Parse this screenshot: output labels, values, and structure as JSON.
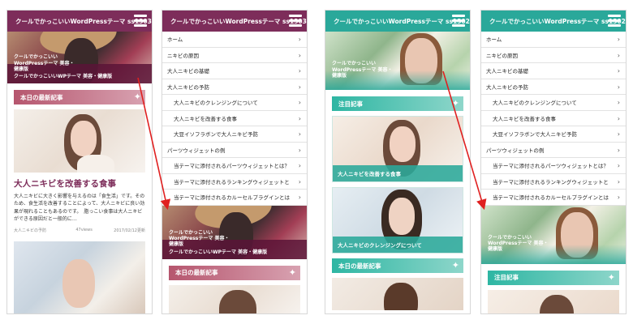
{
  "phones": [
    {
      "theme": "pink",
      "site_title": "クールでかっこいいWordPressテーマ ss1303",
      "hero_small": "クールでかっこいい WordPressテーマ 美容・健康版",
      "hero_caption": "クールでかっこいいWPテーマ 美容・健康版",
      "section_heading": "本日の最新記事",
      "article_title": "大人ニキビを改善する食事",
      "article_body": "大人ニキビに大きく影響を与えるのは「食生活」です。そのため、食生活を改善することによって、大人ニキビに良い効果が現れることもあるのです。　脂っこい食事は大人ニキビができる原因だと一般的に…",
      "meta_category": "大人ニキビの予防",
      "meta_views": "47views",
      "meta_date": "2017/02/12更新"
    },
    {
      "theme": "pink",
      "site_title": "クールでかっこいいWordPressテーマ ss1303",
      "hero_small": "クールでかっこいい WordPressテーマ 美容・健康版",
      "hero_caption": "クールでかっこいいWPテーマ 美容・健康版",
      "section_heading": "本日の最新記事"
    },
    {
      "theme": "teal",
      "site_title": "クールでかっこいいWordPressテーマ ss1302",
      "hero_caption": "クールでかっこいい WordPressテーマ 美容・健康版",
      "section_heading_1": "注目記事",
      "card_1_caption": "大人ニキビを改善する食事",
      "card_2_caption": "大人ニキビのクレンジングについて",
      "section_heading_2": "本日の最新記事"
    },
    {
      "theme": "teal",
      "site_title": "クールでかっこいいWordPressテーマ ss1302",
      "hero_caption": "クールでかっこいい WordPressテーマ 美容・健康版",
      "section_heading": "注目記事"
    }
  ],
  "menu": [
    {
      "label": "ホーム",
      "sub": false
    },
    {
      "label": "ニキビの原因",
      "sub": false
    },
    {
      "label": "大人ニキビの基礎",
      "sub": false
    },
    {
      "label": "大人ニキビの予防",
      "sub": false
    },
    {
      "label": "大人ニキビのクレンジングについて",
      "sub": true
    },
    {
      "label": "大人ニキビを改善する食事",
      "sub": true
    },
    {
      "label": "大豆イソフラボンで大人ニキビ予防",
      "sub": true
    },
    {
      "label": "パーツウィジェットの例",
      "sub": false
    },
    {
      "label": "当テーマに添付されるパーツウィジェットとは？",
      "sub": true
    },
    {
      "label": "当テーマに添付されるランキングウィジェットと",
      "sub": true
    },
    {
      "label": "当テーマに添付されるカルーセルプラグインとは",
      "sub": true
    }
  ],
  "colors": {
    "pink_bar": "#7d2d5a",
    "teal_bar": "#2aa89a",
    "arrow": "#e02020"
  }
}
